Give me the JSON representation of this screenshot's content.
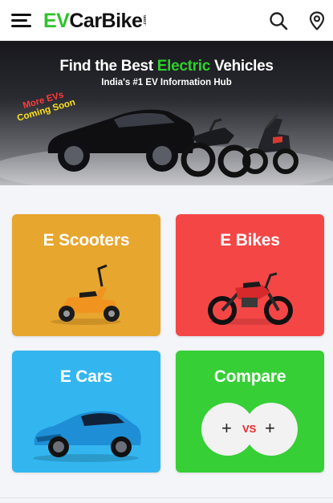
{
  "header": {
    "logo_ev": "EV",
    "logo_carbike": "CarBike",
    "logo_tld": ".com",
    "menu_icon": "hamburger-menu-icon",
    "search_icon": "search-icon",
    "location_icon": "location-pin-icon"
  },
  "hero": {
    "title_before": "Find the Best ",
    "title_accent": "Electric",
    "title_after": " Vehicles",
    "subtitle": "India's #1 EV Information Hub",
    "promo_line1": "More EVs",
    "promo_line2": "Coming Soon",
    "colors": {
      "accent": "#2fd12a",
      "promo_red": "#ff3a3a",
      "promo_yellow": "#ffe11a"
    }
  },
  "categories": [
    {
      "label": "E Scooters",
      "color": "#e7a62d",
      "image": "electric-scooter-image"
    },
    {
      "label": "E Bikes",
      "color": "#f54646",
      "image": "electric-motorbike-image"
    },
    {
      "label": "E Cars",
      "color": "#33b6ef",
      "image": "electric-car-image"
    },
    {
      "label": "Compare",
      "color": "#36cf36",
      "image": "compare-icon"
    }
  ],
  "compare": {
    "plus_left": "+",
    "vs": "VS",
    "plus_right": "+"
  }
}
